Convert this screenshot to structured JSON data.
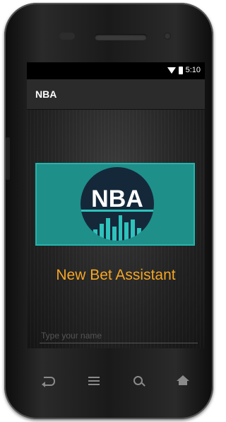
{
  "status_bar": {
    "time": "5:10",
    "wifi_icon": "wifi-icon",
    "battery_icon": "battery-icon"
  },
  "action_bar": {
    "title": "NBA"
  },
  "logo": {
    "text": "NBA",
    "background_color": "#1f8f8a",
    "circle_color": "#15283a",
    "accent_color": "#2ec2bc"
  },
  "headline": {
    "text": "New Bet Assistant",
    "color": "#f5a623"
  },
  "name_input": {
    "placeholder": "Type your name",
    "value": ""
  },
  "nav_bar": {
    "buttons": [
      {
        "icon": "back-icon"
      },
      {
        "icon": "menu-icon"
      },
      {
        "icon": "search-icon"
      },
      {
        "icon": "home-icon"
      }
    ]
  }
}
